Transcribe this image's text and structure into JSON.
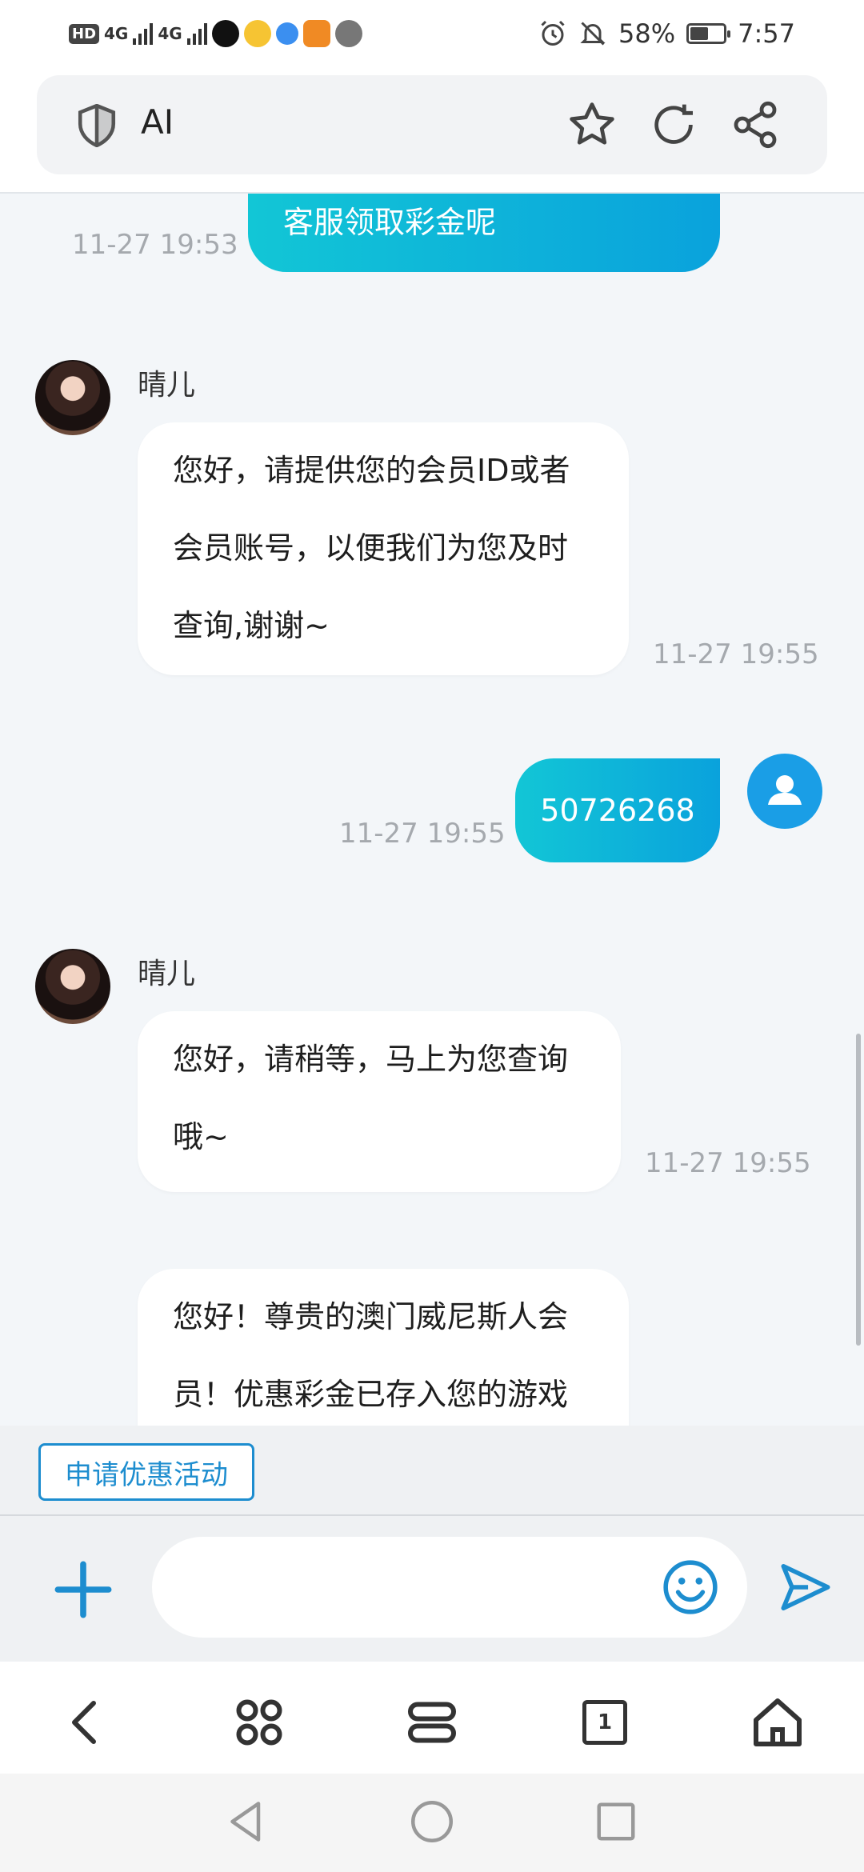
{
  "status_bar": {
    "hd_label": "HD",
    "network_1": "4G",
    "network_2": "4G",
    "battery_percent": "58%",
    "battery_level": 0.58,
    "time": "7:57"
  },
  "browser": {
    "url_text": "AI"
  },
  "chat": {
    "messages": [
      {
        "text": "客服领取彩金呢",
        "timestamp": "11-27 19:53"
      },
      {
        "sender": "晴儿",
        "text_lines": [
          "您好，请提供您的会员ID或者",
          "会员账号，以便我们为您及时",
          "查询,谢谢~"
        ],
        "timestamp": "11-27 19:55"
      },
      {
        "text": "50726268",
        "timestamp": "11-27 19:55"
      },
      {
        "sender": "晴儿",
        "text_lines": [
          "您好，请稍等，马上为您查询",
          "哦~"
        ],
        "timestamp": "11-27 19:55"
      },
      {
        "text_lines": [
          "您好！尊贵的澳门威尼斯人会",
          "员！优惠彩金已存入您的游戏"
        ]
      }
    ]
  },
  "quick_action": {
    "label": "申请优惠活动"
  },
  "input": {
    "placeholder": ""
  },
  "bottom_nav": {
    "tab_count": "1"
  },
  "colors": {
    "accent": "#1d8dcf",
    "bubble_gradient_start": "#12c6d6",
    "bubble_gradient_end": "#0aa2dc"
  }
}
